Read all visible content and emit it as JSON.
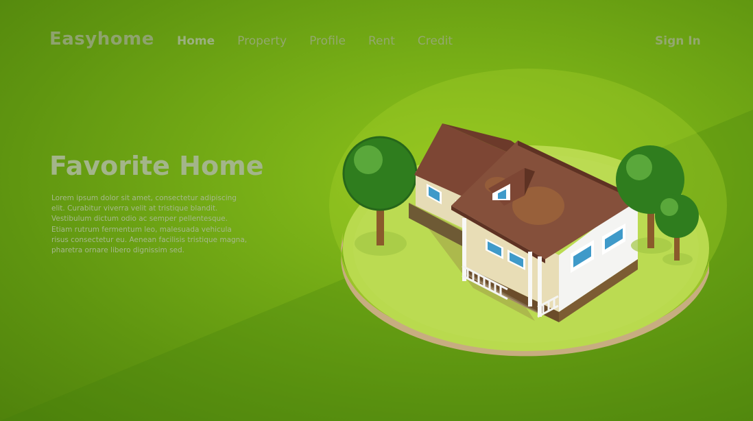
{
  "brand": {
    "name": "Easyhome"
  },
  "nav": {
    "items": [
      {
        "label": "Home",
        "active": true
      },
      {
        "label": "Property",
        "active": false
      },
      {
        "label": "Profile",
        "active": false
      },
      {
        "label": "Rent",
        "active": false
      },
      {
        "label": "Credit",
        "active": false
      }
    ],
    "sign_in": "Sign In"
  },
  "hero": {
    "title": "Favorite Home",
    "body": "Lorem ipsum dolor sit amet, consectetur adipiscing elit. Curabitur viverra velit at tristique blandit. Vestibulum dictum odio ac semper pellentesque. Etiam rutrum fermentum leo, malesuada vehicula risus consectetur eu. Aenean facilisis tristique magna, pharetra ornare libero dignissim sed."
  },
  "colors": {
    "background": "#76ad16",
    "roof": "#7a4634",
    "wall": "#e6ddb8",
    "tree": "#2e7d1f",
    "platform_top": "#b5d84a",
    "platform_side": "#c8ae82"
  }
}
